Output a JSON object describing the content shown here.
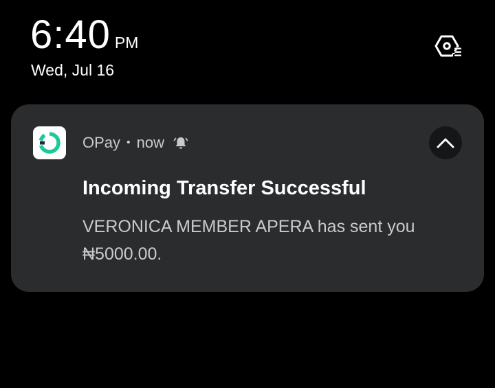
{
  "lockscreen": {
    "time": "6:40",
    "ampm": "PM",
    "date": "Wed, Jul 16",
    "settings_icon": "notification-settings-icon"
  },
  "notification": {
    "app_name": "OPay",
    "separator": "•",
    "timestamp": "now",
    "alert_icon": "bell-icon",
    "collapse_icon": "chevron-up-icon",
    "title": "Incoming Transfer Successful",
    "body": "VERONICA MEMBER APERA has sent you ₦5000.00.",
    "app_icon_color": "#1dc99a",
    "card_color": "#2b2c2e"
  }
}
